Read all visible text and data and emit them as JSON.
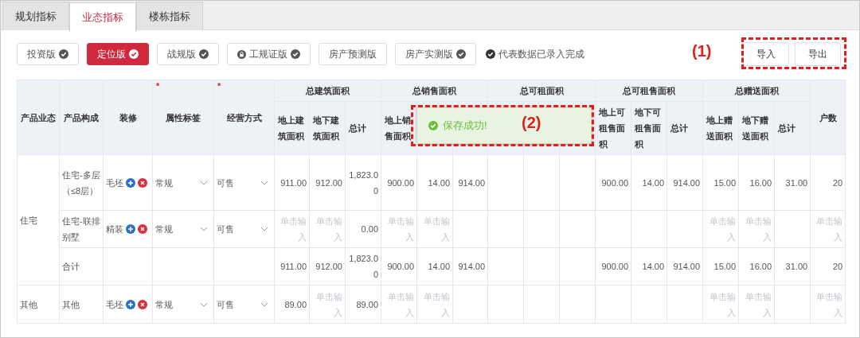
{
  "tabs": [
    {
      "label": "规划指标",
      "selected": false
    },
    {
      "label": "业态指标",
      "selected": true
    },
    {
      "label": "楼栋指标",
      "selected": false
    }
  ],
  "versions": [
    {
      "label": "投资版",
      "selected": false,
      "completed": true,
      "locked": false
    },
    {
      "label": "定位版",
      "selected": true,
      "completed": true,
      "locked": false
    },
    {
      "label": "战规版",
      "selected": false,
      "completed": true,
      "locked": false
    },
    {
      "label": "工规证版",
      "selected": false,
      "completed": true,
      "locked": true
    },
    {
      "label": "房产预测版",
      "selected": false,
      "completed": false,
      "locked": false
    },
    {
      "label": "房产实测版",
      "selected": false,
      "completed": true,
      "locked": false
    }
  ],
  "legend": "代表数据已录入完成",
  "actions": [
    "导入",
    "导出"
  ],
  "table": {
    "fixed_columns": [
      {
        "label": "产品业态",
        "required": false
      },
      {
        "label": "产品构成",
        "required": false
      },
      {
        "label": "装修",
        "required": false
      },
      {
        "label": "属性标签",
        "required": true
      },
      {
        "label": "经营方式",
        "required": true
      }
    ],
    "required_mark": "*",
    "groups": [
      {
        "label": "总建筑面积",
        "columns": [
          {
            "kind": "label",
            "text": "地上建筑面积"
          },
          {
            "kind": "label",
            "text": "地下建筑面积"
          },
          {
            "kind": "label",
            "text": "总计"
          }
        ]
      },
      {
        "label": "总销售面积",
        "columns": [
          {
            "kind": "label",
            "text": "地上销售面积"
          },
          {
            "kind": "hidden"
          },
          {
            "kind": "hidden"
          }
        ]
      },
      {
        "label": "总可租面积",
        "columns": [
          {
            "kind": "hidden"
          },
          {
            "kind": "hidden"
          },
          {
            "kind": "hidden"
          }
        ]
      },
      {
        "label": "总可租售面积",
        "columns": [
          {
            "kind": "label",
            "text": "地上可租售面积"
          },
          {
            "kind": "label",
            "text": "地下可租售面积"
          },
          {
            "kind": "label",
            "text": "总计"
          }
        ]
      },
      {
        "label": "总赠送面积",
        "columns": [
          {
            "kind": "label",
            "text": "地上赠送面积"
          },
          {
            "kind": "label",
            "text": "地下赠送面积"
          },
          {
            "kind": "label",
            "text": "总计"
          }
        ]
      }
    ],
    "last_column": "户数",
    "sections": [
      {
        "category": "住宅",
        "rows": [
          {
            "kind": "item",
            "composition": "住宅-多层（≤8层）",
            "decoration": "毛坯",
            "attribute": "常规",
            "operation": "可售",
            "values": [
              {
                "kind": "number",
                "text": "911.00"
              },
              {
                "kind": "number",
                "text": "912.00"
              },
              {
                "kind": "number",
                "text": "1,823.00"
              },
              {
                "kind": "number",
                "text": "900.00"
              },
              {
                "kind": "number",
                "text": "14.00"
              },
              {
                "kind": "number",
                "text": "914.00"
              },
              {
                "kind": "empty"
              },
              {
                "kind": "empty"
              },
              {
                "kind": "empty"
              },
              {
                "kind": "number",
                "text": "900.00"
              },
              {
                "kind": "number",
                "text": "14.00"
              },
              {
                "kind": "number",
                "text": "914.00"
              },
              {
                "kind": "number",
                "text": "15.00"
              },
              {
                "kind": "number",
                "text": "16.00"
              },
              {
                "kind": "number",
                "text": "31.00"
              },
              {
                "kind": "number",
                "text": "20"
              }
            ]
          },
          {
            "kind": "item",
            "composition": "住宅-联排别墅",
            "decoration": "精装",
            "attribute": "常规",
            "operation": "可售",
            "values": [
              {
                "kind": "placeholder",
                "text": "单击输入"
              },
              {
                "kind": "placeholder",
                "text": "单击输入"
              },
              {
                "kind": "number",
                "text": "0.00"
              },
              {
                "kind": "placeholder",
                "text": "单击输入"
              },
              {
                "kind": "placeholder",
                "text": "单击输入"
              },
              {
                "kind": "empty"
              },
              {
                "kind": "empty"
              },
              {
                "kind": "empty"
              },
              {
                "kind": "empty"
              },
              {
                "kind": "empty"
              },
              {
                "kind": "empty"
              },
              {
                "kind": "empty"
              },
              {
                "kind": "placeholder",
                "text": "单击输入"
              },
              {
                "kind": "placeholder",
                "text": "单击输入"
              },
              {
                "kind": "empty"
              },
              {
                "kind": "placeholder",
                "text": "单击输入"
              }
            ]
          },
          {
            "kind": "total",
            "composition": "合计",
            "values": [
              {
                "kind": "number",
                "text": "911.00"
              },
              {
                "kind": "number",
                "text": "912.00"
              },
              {
                "kind": "number",
                "text": "1,823.00"
              },
              {
                "kind": "number",
                "text": "900.00"
              },
              {
                "kind": "number",
                "text": "14.00"
              },
              {
                "kind": "number",
                "text": "914.00"
              },
              {
                "kind": "empty"
              },
              {
                "kind": "empty"
              },
              {
                "kind": "empty"
              },
              {
                "kind": "number",
                "text": "900.00"
              },
              {
                "kind": "number",
                "text": "14.00"
              },
              {
                "kind": "number",
                "text": "914.00"
              },
              {
                "kind": "number",
                "text": "15.00"
              },
              {
                "kind": "number",
                "text": "16.00"
              },
              {
                "kind": "number",
                "text": "31.00"
              },
              {
                "kind": "number",
                "text": "20"
              }
            ]
          }
        ]
      },
      {
        "category": "其他",
        "rows": [
          {
            "kind": "item",
            "composition": "其他",
            "decoration": "毛坯",
            "attribute": "常规",
            "operation": "可售",
            "values": [
              {
                "kind": "number",
                "text": "89.00"
              },
              {
                "kind": "placeholder",
                "text": "单击输入"
              },
              {
                "kind": "number",
                "text": "89.00"
              },
              {
                "kind": "placeholder",
                "text": "单击输入"
              },
              {
                "kind": "placeholder",
                "text": "单击输入"
              },
              {
                "kind": "empty"
              },
              {
                "kind": "empty"
              },
              {
                "kind": "empty"
              },
              {
                "kind": "empty"
              },
              {
                "kind": "empty"
              },
              {
                "kind": "empty"
              },
              {
                "kind": "empty"
              },
              {
                "kind": "placeholder",
                "text": "单击输入"
              },
              {
                "kind": "placeholder",
                "text": "单击输入"
              },
              {
                "kind": "empty"
              },
              {
                "kind": "placeholder",
                "text": "单击输入"
              }
            ]
          }
        ]
      }
    ]
  },
  "toast": {
    "message": "保存成功!",
    "kind": "success"
  },
  "annotations": [
    {
      "label": "(1)"
    },
    {
      "label": "(2)"
    }
  ]
}
